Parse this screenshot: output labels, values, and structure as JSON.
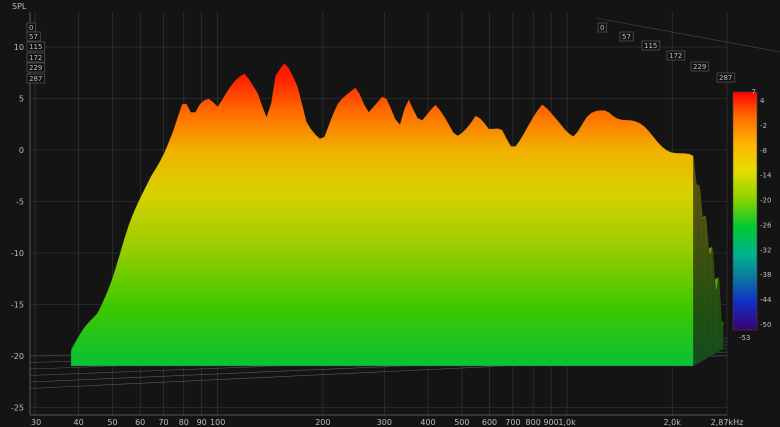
{
  "chart_data": {
    "type": "waterfall-3d",
    "ylabel": "SPL",
    "y_ticks": [
      "10",
      "5",
      "0",
      "-5",
      "-10",
      "-15",
      "-20",
      "-25"
    ],
    "x_ticks": [
      "30",
      "40",
      "50",
      "60",
      "70",
      "80",
      "90",
      "100",
      "200",
      "300",
      "400",
      "500",
      "600",
      "700",
      "800",
      "900",
      "1,0k",
      "2,0k",
      "2,87kHz"
    ],
    "time_ticks": [
      "0",
      "57",
      "115",
      "172",
      "229",
      "287"
    ],
    "colorbar": {
      "ticks": [
        "7",
        "4",
        "-2",
        "-8",
        "-14",
        "-20",
        "-26",
        "-32",
        "-38",
        "-44",
        "-50",
        "-53"
      ],
      "colors": [
        "#ff0000",
        "#ff8c00",
        "#ffd700",
        "#c8e600",
        "#5ad200",
        "#00c832",
        "#00b47a",
        "#0a78a0",
        "#0040c8",
        "#2020c8",
        "#4b0082",
        "#300060"
      ]
    },
    "surface": {
      "x_range_hz": [
        38,
        2300
      ],
      "y_range_db": [
        -25,
        10
      ],
      "slice_count": 85,
      "front_response_db": [
        [
          38,
          -19.5
        ],
        [
          45,
          -16
        ],
        [
          50,
          -12
        ],
        [
          55,
          -8
        ],
        [
          60,
          -5
        ],
        [
          65,
          -2
        ],
        [
          70,
          0
        ],
        [
          75,
          2
        ],
        [
          80,
          4.5
        ],
        [
          85,
          3
        ],
        [
          90,
          5
        ],
        [
          95,
          5.5
        ],
        [
          100,
          4.5
        ],
        [
          110,
          6
        ],
        [
          120,
          7.3
        ],
        [
          130,
          6
        ],
        [
          140,
          3
        ],
        [
          145,
          7
        ],
        [
          155,
          8
        ],
        [
          160,
          7.5
        ],
        [
          170,
          6
        ],
        [
          180,
          3
        ],
        [
          200,
          1
        ],
        [
          220,
          4
        ],
        [
          250,
          6.5
        ],
        [
          270,
          4
        ],
        [
          300,
          5
        ],
        [
          330,
          2
        ],
        [
          350,
          5.5
        ],
        [
          380,
          3
        ],
        [
          420,
          4
        ],
        [
          480,
          1.5
        ],
        [
          550,
          3.5
        ],
        [
          600,
          1.5
        ],
        [
          650,
          2
        ],
        [
          700,
          0.5
        ],
        [
          780,
          2.5
        ],
        [
          850,
          4
        ],
        [
          950,
          3
        ],
        [
          1050,
          1.5
        ],
        [
          1150,
          3
        ],
        [
          1300,
          4
        ],
        [
          1500,
          3
        ],
        [
          1800,
          1
        ],
        [
          2300,
          -1
        ]
      ]
    }
  }
}
